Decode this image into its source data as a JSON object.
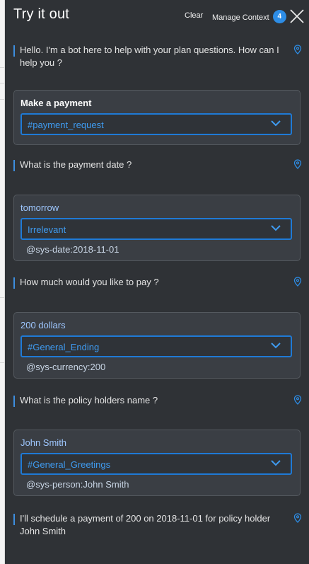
{
  "header": {
    "title": "Try it out",
    "clear_label": "Clear",
    "manage_context_label": "Manage Context",
    "context_count": "4"
  },
  "messages": [
    {
      "text": "Hello. I'm a bot here to help with your plan questions. How can I help you ?"
    },
    {
      "text": "What is the payment date ?"
    },
    {
      "text": "How much would you like to pay ?"
    },
    {
      "text": "What is the policy holders name ?"
    },
    {
      "text": "I'll schedule a payment of 200 on 2018-11-01 for policy holder John Smith"
    }
  ],
  "inputs": [
    {
      "text": "Make a payment",
      "intent": "#payment_request",
      "entity": ""
    },
    {
      "text": "tomorrow",
      "intent": "Irrelevant",
      "entity": "@sys-date:2018-11-01"
    },
    {
      "text": "200 dollars",
      "intent": "#General_Ending",
      "entity": "@sys-currency:200"
    },
    {
      "text": "John Smith",
      "intent": "#General_Greetings",
      "entity": "@sys-person:John Smith"
    }
  ],
  "icons": {
    "close": "close-icon",
    "pin": "location-pin-icon",
    "chevron": "chevron-down-icon"
  },
  "colors": {
    "panel_bg": "#2f3236",
    "card_bg": "#3a3e44",
    "accent": "#2d8de6",
    "intent_text": "#3f9bf0",
    "user_text": "#9ec7ff"
  }
}
